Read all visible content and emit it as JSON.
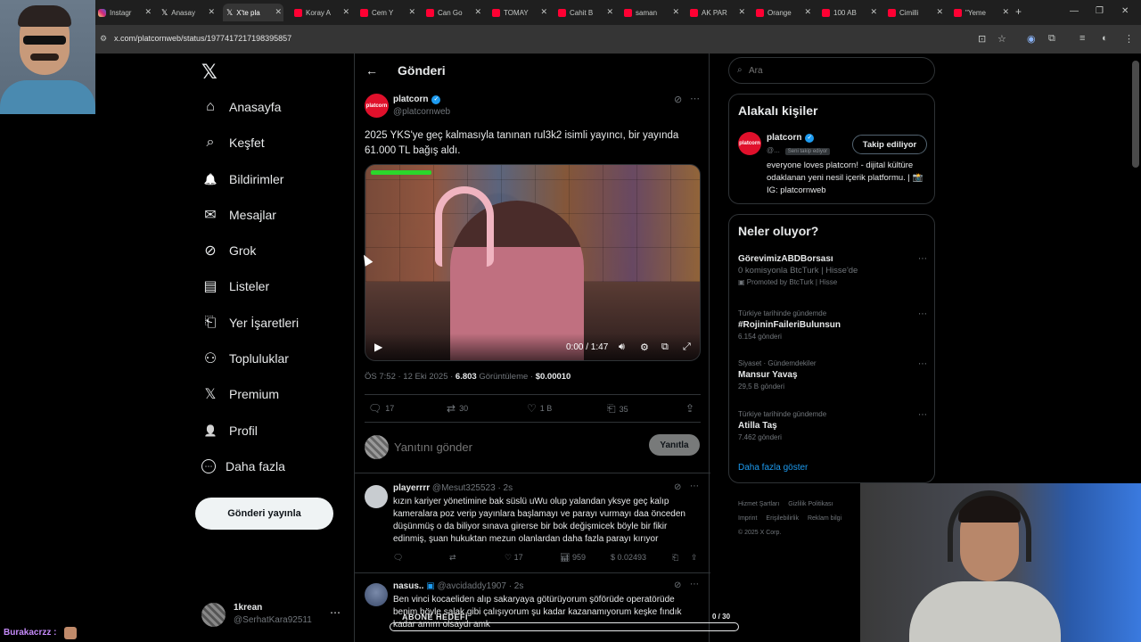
{
  "browser": {
    "tabs": [
      {
        "label": "Instagr",
        "icon": "instagram-icon"
      },
      {
        "label": "Anasay",
        "icon": "x-icon"
      },
      {
        "label": "X'te pla",
        "icon": "x-icon",
        "active": true
      },
      {
        "label": "Koray A",
        "icon": "youtube-icon"
      },
      {
        "label": "Cem Y",
        "icon": "youtube-icon"
      },
      {
        "label": "Can Go",
        "icon": "youtube-icon"
      },
      {
        "label": "TOMAY",
        "icon": "youtube-icon"
      },
      {
        "label": "Cahit B",
        "icon": "youtube-icon"
      },
      {
        "label": "saman",
        "icon": "youtube-icon"
      },
      {
        "label": "AK PAR",
        "icon": "youtube-icon"
      },
      {
        "label": "Orange",
        "icon": "youtube-icon"
      },
      {
        "label": "100 AB",
        "icon": "youtube-icon"
      },
      {
        "label": "Cimilli",
        "icon": "youtube-icon"
      },
      {
        "label": "\"Yeme",
        "icon": "youtube-icon"
      }
    ],
    "url": "x.com/platcornweb/status/1977417217198395857"
  },
  "nav": {
    "items": [
      {
        "label": "Anasayfa",
        "icon": "home-icon",
        "glyph": "⌂"
      },
      {
        "label": "Keşfet",
        "icon": "search-icon",
        "glyph": "⌕"
      },
      {
        "label": "Bildirimler",
        "icon": "bell-icon",
        "glyph": "🔔"
      },
      {
        "label": "Mesajlar",
        "icon": "mail-icon",
        "glyph": "✉"
      },
      {
        "label": "Grok",
        "icon": "grok-icon",
        "glyph": "⊘"
      },
      {
        "label": "Listeler",
        "icon": "list-icon",
        "glyph": "▤"
      },
      {
        "label": "Yer İşaretleri",
        "icon": "bookmark-icon",
        "glyph": "⎗"
      },
      {
        "label": "Topluluklar",
        "icon": "communities-icon",
        "glyph": "⚇"
      },
      {
        "label": "Premium",
        "icon": "x-logo-icon",
        "glyph": "𝕏"
      },
      {
        "label": "Profil",
        "icon": "profile-icon",
        "glyph": "👤"
      },
      {
        "label": "Daha fazla",
        "icon": "more-circle-icon",
        "glyph": "⋯"
      }
    ],
    "post_button": "Gönderi yayınla",
    "account": {
      "name": "1krean",
      "handle": "@SerhatKara92511"
    }
  },
  "post": {
    "header": "Gönderi",
    "author_name": "platcorn",
    "author_handle": "@platcornweb",
    "avatar_text": "platcorn",
    "text": "2025 YKS'ye geç kalmasıyla tanınan rul3k2 isimli yayıncı, bir yayında 61.000 TL bağış aldı.",
    "video": {
      "time": "0:00 / 1:47",
      "progress": 0
    },
    "meta_time": "ÖS 7:52 · 12 Eki 2025 · ",
    "views_value": "6.803",
    "views_label": " Görüntüleme · ",
    "money": "$0.00010",
    "stats": {
      "replies": "17",
      "reposts": "30",
      "likes": "1 B",
      "bookmarks": "35"
    },
    "reply_placeholder": "Yanıtını gönder",
    "reply_button": "Yanıtla"
  },
  "replies": [
    {
      "name": "playerrrr",
      "handle": "@Mesut325523 · 2s",
      "text": "kızın kariyer yönetimine bak süslü uWu olup yalandan yksye geç kalıp kameralara poz verip yayınlara başlamayı ve parayı vurmayı daa önceden düşünmüş o da biliyor sınava girerse bir bok değişmicek böyle bir fikir edinmiş, şuan hukuktan mezun olanlardan daha fazla parayı kırıyor",
      "replies": "",
      "reposts": "",
      "likes": "17",
      "views": "959",
      "money": "$ 0.02493"
    },
    {
      "name": "nasus..",
      "handle": "@avcidaddy1907 · 2s",
      "text": "Ben vinci kocaeliden alıp sakaryaya götürüyorum şöförüde operatörüde benim böyle salak gibi çalışıyorum şu kadar kazanamıyorum keşke fındık kadar amım olsaydı amk"
    }
  ],
  "right": {
    "search_placeholder": "Ara",
    "related_title": "Alakalı kişiler",
    "related": {
      "name": "platcorn",
      "handle": "@...",
      "badge": "Seni takip ediyor",
      "follow_label": "Takip ediliyor",
      "bio": "everyone loves platcorn! - dijital kültüre odaklanan yeni nesil içerik platformu. | 📸 IG: platcornweb"
    },
    "trends_title": "Neler oluyor?",
    "trends": [
      {
        "name": "GörevimizABDBorsası",
        "sub": "0 komisyonla BtcTurk | Hisse'de",
        "promo": "Promoted by BtcTurk | Hisse"
      },
      {
        "category": "Türkiye tarihinde gündemde",
        "name": "#RojininFaileriBulunsun",
        "posts": "6.154 gönderi"
      },
      {
        "category": "Siyaset · Gündemdekiler",
        "name": "Mansur Yavaş",
        "posts": "29,5 B gönderi"
      },
      {
        "category": "Türkiye tarihinde gündemde",
        "name": "Atilla Taş",
        "posts": "7.462 gönderi"
      }
    ],
    "show_more": "Daha fazla göster",
    "footer": [
      "Hizmet Şartları",
      "Gizlilik Politikası",
      "Imprint",
      "Erişilebilirlik",
      "Reklam bilgi",
      "© 2025 X Corp."
    ]
  },
  "overlay": {
    "chat_user": "Burakacrzz :",
    "goal_label": "ABONE HEDEFİ",
    "goal_count": "0 / 30"
  }
}
